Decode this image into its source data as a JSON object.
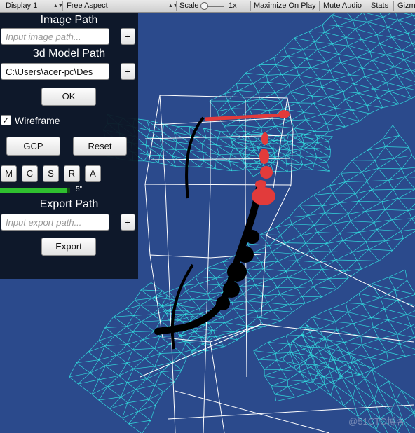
{
  "toolbar": {
    "display": "Display 1",
    "aspect": "Free Aspect",
    "scale_label": "Scale",
    "scale_value": "1x",
    "maximize_on_play": "Maximize On Play",
    "mute_audio": "Mute Audio",
    "stats": "Stats",
    "gizmos": "Gizm"
  },
  "panel": {
    "image_path": {
      "heading": "Image Path",
      "placeholder": "Input image path...",
      "value": "",
      "browse": "+"
    },
    "model_path": {
      "heading": "3d Model Path",
      "value": "C:\\Users\\acer-pc\\Des",
      "browse": "+"
    },
    "ok": "OK",
    "wireframe": {
      "label": "Wireframe",
      "checked": true,
      "check_glyph": "✓"
    },
    "gcp": "GCP",
    "reset": "Reset",
    "modes": [
      "M",
      "C",
      "S",
      "R",
      "A"
    ],
    "slider": {
      "value_label": "5\"",
      "fraction": 0.95
    },
    "export_path": {
      "heading": "Export Path",
      "placeholder": "Input export path...",
      "value": "",
      "browse": "+"
    },
    "export": "Export"
  },
  "scene": {
    "background_color": "#2b4a8c",
    "wire_color": "#33e0e0",
    "box_color": "#ffffff",
    "marker_color": "#e23b3b",
    "path_color": "#000000"
  },
  "watermark": "@51CTO博客"
}
